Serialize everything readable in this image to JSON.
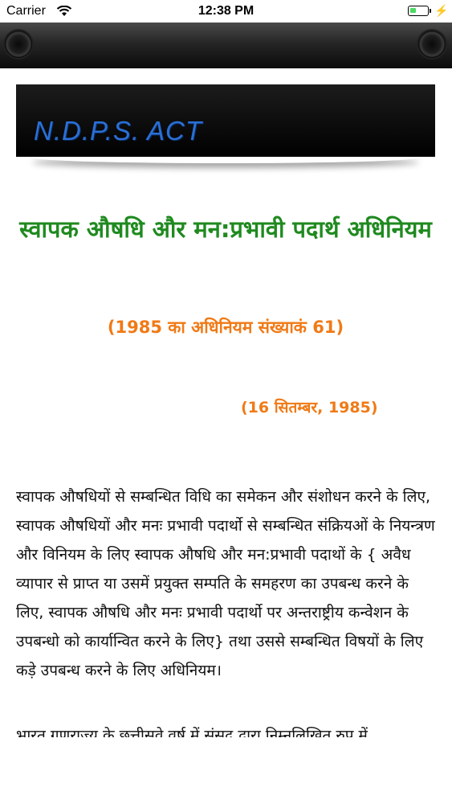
{
  "status_bar": {
    "carrier": "Carrier",
    "time": "12:38 PM",
    "battery_level": 0.35,
    "icons": [
      "wifi-icon",
      "battery-icon",
      "charging-bolt-icon"
    ]
  },
  "nav_bar": {
    "left_button_icon": "circle-knob-icon",
    "right_button_icon": "circle-knob-icon"
  },
  "document": {
    "banner_title": "N.D.P.S. ACT",
    "title": "स्वापक औषधि और मन:प्रभावी पदार्थ अधिनियम",
    "act_number": "(1985 का अधिनियम संख्याकं 61)",
    "date": "(16 सितम्बर, 1985)",
    "preamble": "स्वापक औषधियों से सम्बन्धित विधि का समेकन और संशोधन करने के लिए, स्वापक औषधियों और मनः प्रभावी पदार्थो से सम्बन्धित संक्रियओं के नियन्त्रण और विनियम के लिए स्वापक औषधि और मन:प्रभावी पदाथों के { अवैध व्यापार से प्राप्त या उसमें प्रयुक्त सम्पति के समहरण का उपबन्ध करने के लिए, स्वापक औषधि और मनः प्रभावी पदार्थो पर अन्तराष्ट्रीय कन्वेेशन के उपबन्धो को कार्यान्वित करने के लिए} तथा उससे सम्बन्धित विषयों के लिए कड़े उपबन्ध करने के लिए अधिनियम।",
    "enactment": "भारत गणराज्य के छत्तीसवे  वर्ष में संसद द्वारा निम्नलिखित रुप में"
  },
  "colors": {
    "title_green": "#1f8a1f",
    "accent_orange": "#f07a16",
    "banner_blue": "#2a6fd6"
  }
}
